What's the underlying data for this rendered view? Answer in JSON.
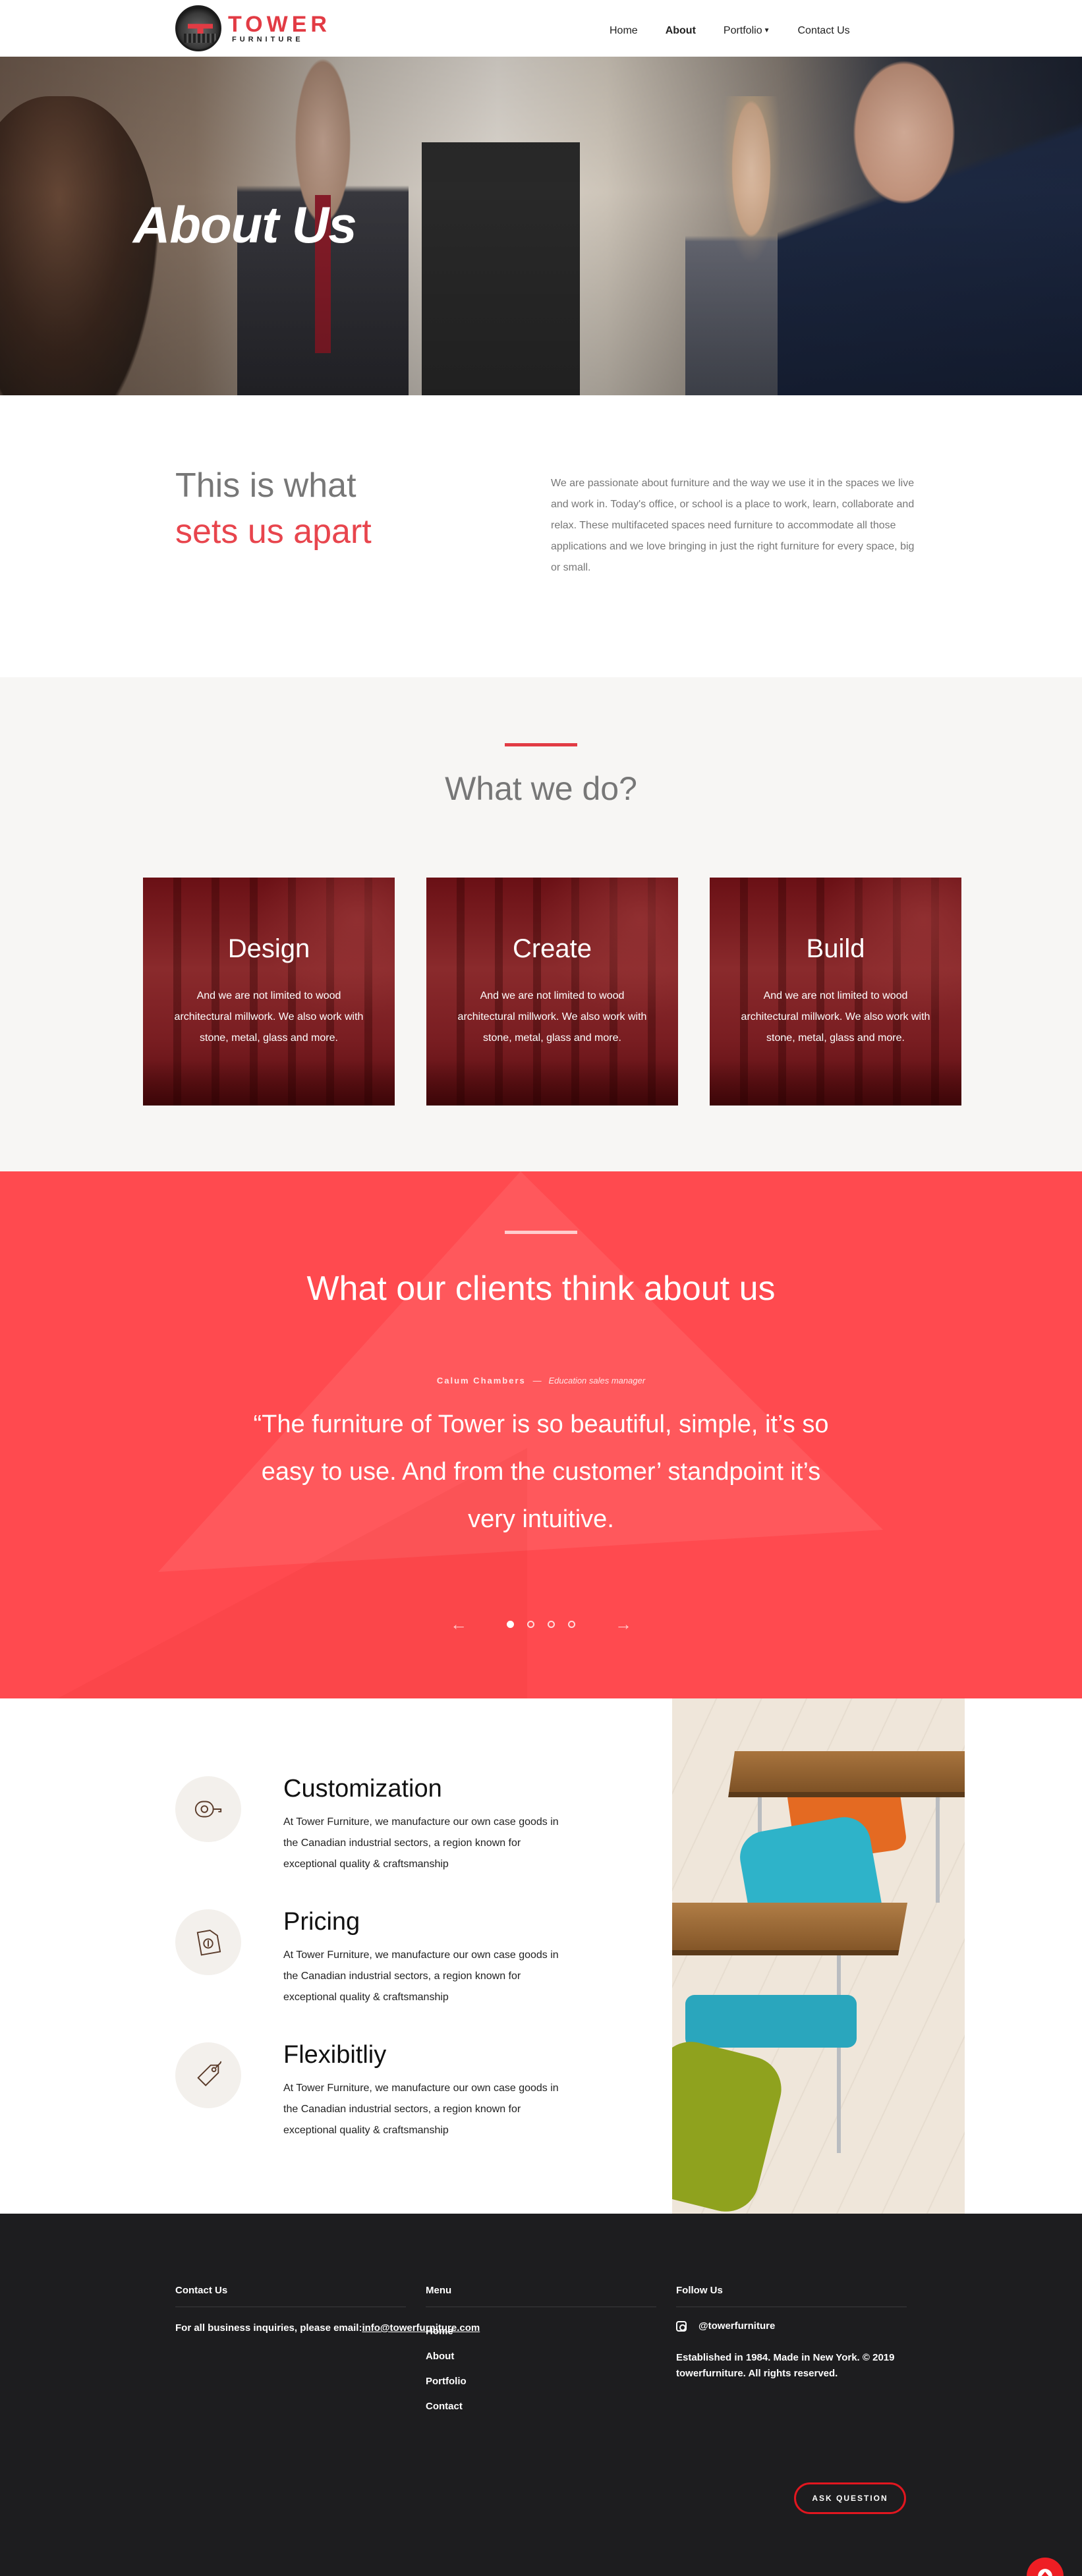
{
  "brand": {
    "name": "TOWER",
    "sub": "FURNITURE"
  },
  "nav": {
    "items": [
      {
        "label": "Home",
        "active": false
      },
      {
        "label": "About",
        "active": true
      },
      {
        "label": "Portfolio",
        "active": false,
        "dropdown": true
      },
      {
        "label": "Contact Us",
        "active": false
      }
    ]
  },
  "hero": {
    "title": "About Us"
  },
  "about": {
    "heading_line1": "This is what",
    "heading_line2": "sets us apart",
    "body": "We are passionate about furniture and the way we use it in the spaces we live and work in. Today's office, or school is a place to work, learn, collaborate and relax. These multifaceted spaces need furniture to accommodate all those applications and we love bringing in just the right furniture for every space, big or small."
  },
  "whatwedo": {
    "title": "What we do?",
    "cards": [
      {
        "title": "Design",
        "text": "And we are not limited to wood architectural millwork. We also work with stone, metal, glass and more."
      },
      {
        "title": "Create",
        "text": "And we are not limited to wood architectural millwork. We also work with stone, metal, glass and more."
      },
      {
        "title": "Build",
        "text": "And we are not limited to wood architectural millwork. We also work with stone, metal, glass and more."
      }
    ]
  },
  "testimonials": {
    "title": "What our clients think about us",
    "author_name": "Calum Chambers",
    "separator": "—",
    "author_role": "Education sales manager",
    "quote": "“The furniture of Tower is so beautiful, simple, it’s so easy to use. And from the customer’ standpoint it’s very intuitive.",
    "prev_icon": "←",
    "next_icon": "→",
    "slide_count": 4,
    "active_slide": 1
  },
  "features": [
    {
      "icon": "tape-measure-icon",
      "title": "Customization",
      "text": "At Tower Furniture, we manufacture our own case goods in the Canadian industrial sectors, a region known for exceptional quality & craftsmanship"
    },
    {
      "icon": "invoice-dollar-icon",
      "title": "Pricing",
      "text": "At Tower Furniture, we manufacture our own case goods in the Canadian industrial sectors, a region known for exceptional quality & craftsmanship"
    },
    {
      "icon": "price-tag-icon",
      "title": "Flexibitliy",
      "text": "At Tower Furniture, we manufacture our own case goods in the Canadian industrial sectors, a region known for exceptional quality & craftsmanship"
    }
  ],
  "footer": {
    "contact": {
      "heading": "Contact Us",
      "text": "For all business inquiries, please email:",
      "email": "info@towerfurniture.com"
    },
    "menu": {
      "heading": "Menu",
      "items": [
        "Home",
        "About",
        "Portfolio",
        "Contact"
      ]
    },
    "follow": {
      "heading": "Follow Us",
      "handle": "@towerfurniture",
      "established": "Established in 1984. Made in New York. © 2019 towerfurniture. All rights reserved."
    },
    "ask_button": "ASK QUESTION"
  },
  "colors": {
    "accent": "#e8454d",
    "testimonial_bg": "#ff4a4f",
    "footer_bg": "#1d1d1f",
    "scroll_top": "#ee1e24"
  }
}
